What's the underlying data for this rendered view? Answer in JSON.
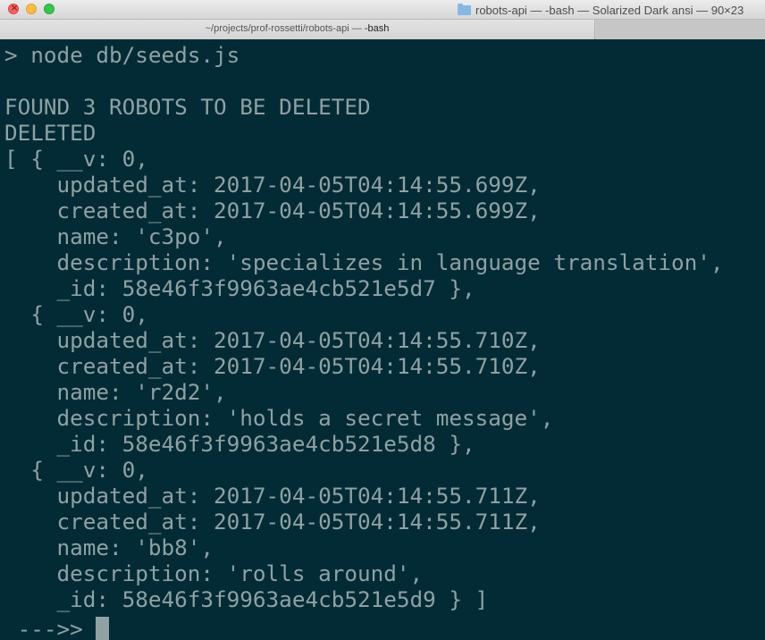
{
  "window": {
    "title": "robots-api — -bash — Solarized Dark ansi — 90×23",
    "folder_icon": "folder-icon"
  },
  "tab": {
    "path": "~/projects/prof-rossetti/robots-api — ",
    "process": "-bash"
  },
  "colors": {
    "background": "#002b36",
    "foreground": "#8fa1a3"
  },
  "terminal": {
    "lines": [
      "> node db/seeds.js",
      "",
      "FOUND 3 ROBOTS TO BE DELETED",
      "DELETED",
      "[ { __v: 0,",
      "    updated_at: 2017-04-05T04:14:55.699Z,",
      "    created_at: 2017-04-05T04:14:55.699Z,",
      "    name: 'c3po',",
      "    description: 'specializes in language translation',",
      "    _id: 58e46f3f9963ae4cb521e5d7 },",
      "  { __v: 0,",
      "    updated_at: 2017-04-05T04:14:55.710Z,",
      "    created_at: 2017-04-05T04:14:55.710Z,",
      "    name: 'r2d2',",
      "    description: 'holds a secret message',",
      "    _id: 58e46f3f9963ae4cb521e5d8 },",
      "  { __v: 0,",
      "    updated_at: 2017-04-05T04:14:55.711Z,",
      "    created_at: 2017-04-05T04:14:55.711Z,",
      "    name: 'bb8',",
      "    description: 'rolls around',",
      "    _id: 58e46f3f9963ae4cb521e5d9 } ]"
    ],
    "prompt": " --->>"
  }
}
